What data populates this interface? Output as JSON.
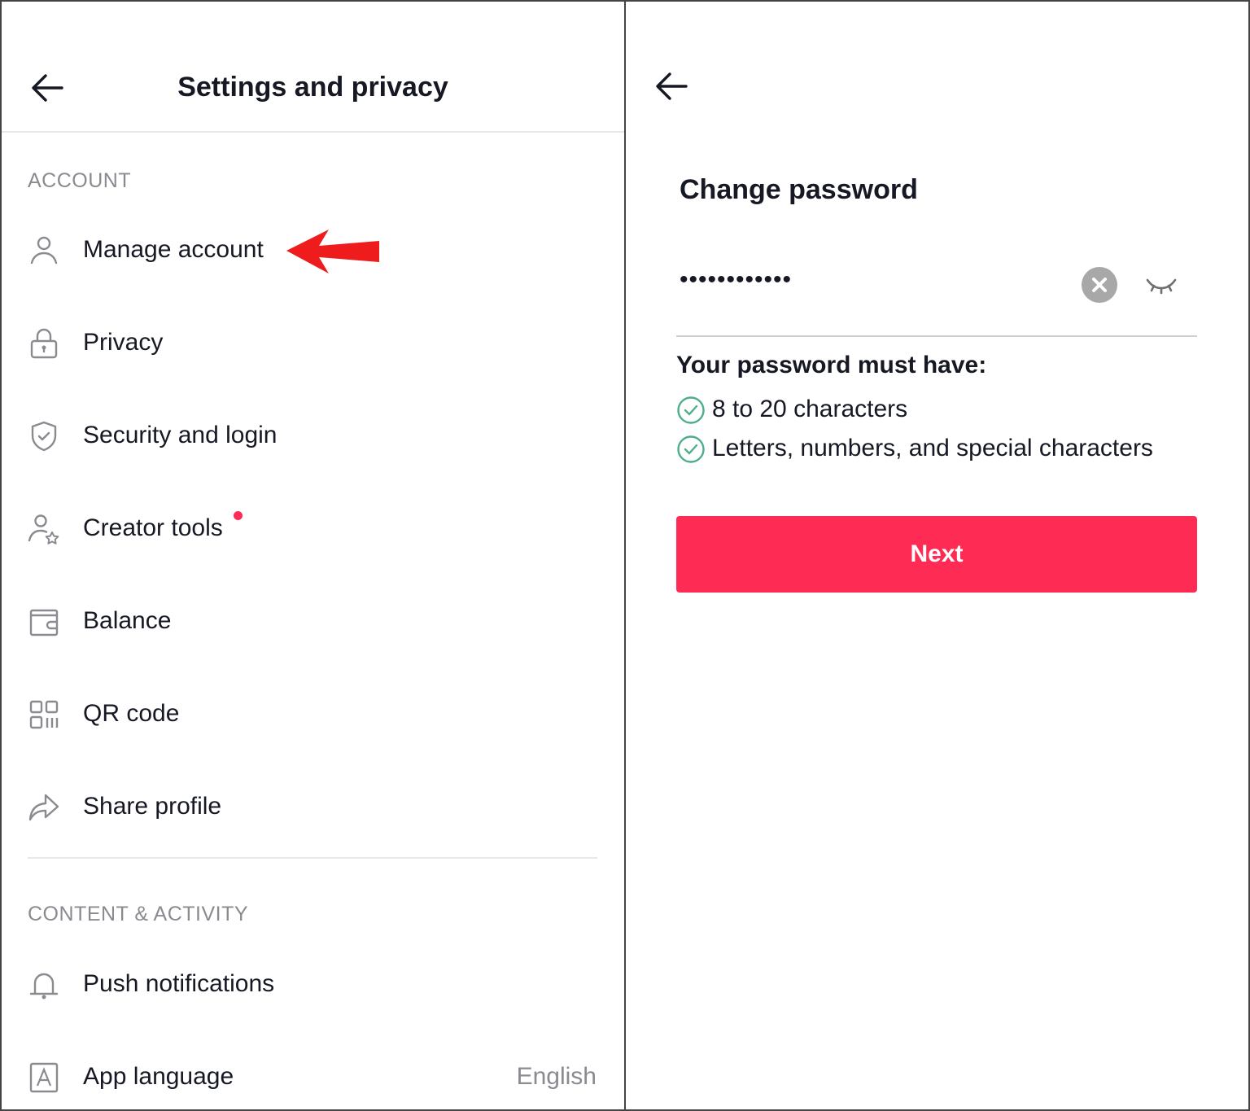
{
  "left_panel": {
    "header": {
      "title": "Settings and privacy",
      "back_icon": "arrow-left-icon"
    },
    "sections": [
      {
        "title": "ACCOUNT",
        "items": [
          {
            "label": "Manage account",
            "icon": "person-icon"
          },
          {
            "label": "Privacy",
            "icon": "lock-icon"
          },
          {
            "label": "Security and login",
            "icon": "shield-check-icon"
          },
          {
            "label": "Creator tools",
            "icon": "person-star-icon",
            "badge": "notification-dot"
          },
          {
            "label": "Balance",
            "icon": "wallet-icon"
          },
          {
            "label": "QR code",
            "icon": "qr-code-icon"
          },
          {
            "label": "Share profile",
            "icon": "share-arrow-icon"
          }
        ]
      },
      {
        "title": "CONTENT & ACTIVITY",
        "items": [
          {
            "label": "Push notifications",
            "icon": "bell-icon"
          },
          {
            "label": "App language",
            "icon": "letter-a-icon",
            "value": "English"
          }
        ]
      }
    ],
    "annotation": {
      "type": "red-arrow",
      "points_to": "Manage account"
    }
  },
  "right_panel": {
    "back_icon": "arrow-left-icon",
    "title": "Change password",
    "password_field": {
      "value": "••••••••••••",
      "clear_icon": "clear-x-icon",
      "toggle_icon": "eye-closed-icon"
    },
    "requirements_heading": "Your password must have:",
    "requirements": [
      {
        "text": "8 to 20 characters",
        "met": true
      },
      {
        "text": "Letters, numbers, and special characters",
        "met": true
      }
    ],
    "next_button": "Next"
  },
  "colors": {
    "accent": "#fe2c55",
    "check": "#4fae8a",
    "muted_text": "#8a8b91",
    "text": "#161823",
    "annotation_arrow": "#ee1c1c"
  }
}
